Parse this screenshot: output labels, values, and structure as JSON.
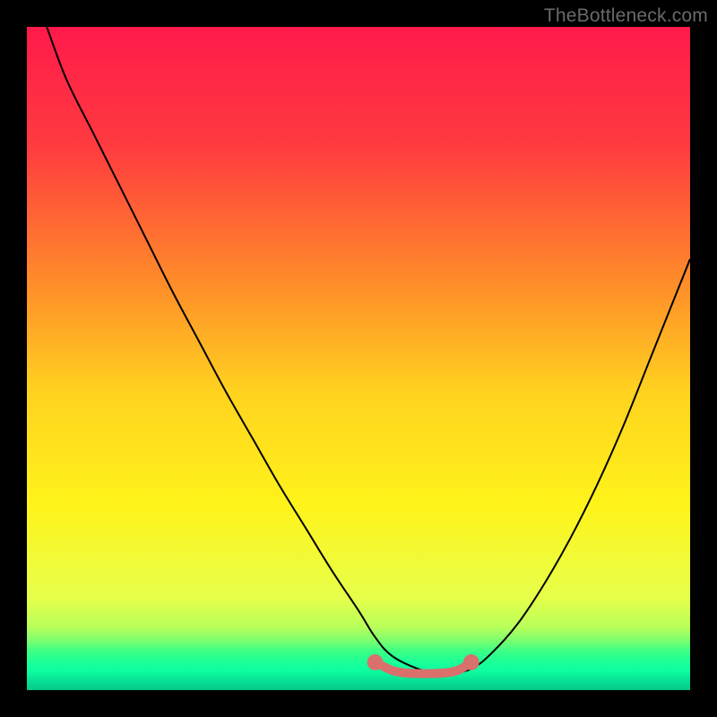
{
  "watermark": "TheBottleneck.com",
  "chart_data": {
    "type": "line",
    "title": "",
    "xlabel": "",
    "ylabel": "",
    "xlim": [
      0,
      100
    ],
    "ylim": [
      0,
      100
    ],
    "gradient_stops": [
      {
        "offset": 0.0,
        "color": "#ff1a4b"
      },
      {
        "offset": 0.18,
        "color": "#ff3b3f"
      },
      {
        "offset": 0.38,
        "color": "#ff8a2a"
      },
      {
        "offset": 0.55,
        "color": "#ffd21f"
      },
      {
        "offset": 0.72,
        "color": "#fff31a"
      },
      {
        "offset": 0.86,
        "color": "#e6ff4a"
      },
      {
        "offset": 0.905,
        "color": "#b8ff5a"
      },
      {
        "offset": 0.925,
        "color": "#7dff6e"
      },
      {
        "offset": 0.94,
        "color": "#3fff84"
      },
      {
        "offset": 0.955,
        "color": "#1fff95"
      },
      {
        "offset": 0.97,
        "color": "#0dffa0"
      },
      {
        "offset": 0.985,
        "color": "#07e296"
      },
      {
        "offset": 1.0,
        "color": "#04c987"
      }
    ],
    "series": [
      {
        "name": "bottleneck-curve",
        "color": "#000000",
        "stroke_width": 2,
        "x": [
          3,
          6,
          10,
          14,
          18,
          22,
          26,
          30,
          34,
          38,
          42,
          46,
          50,
          52.5,
          55,
          59,
          62,
          64,
          67,
          70,
          74,
          78,
          82,
          86,
          90,
          94,
          98,
          100
        ],
        "y": [
          100,
          92,
          84,
          76,
          68,
          60,
          52.5,
          45,
          38,
          31,
          24.5,
          18,
          12,
          8,
          5.2,
          3.2,
          2.6,
          2.6,
          3.2,
          5.5,
          10,
          16,
          23,
          31,
          40,
          50,
          60,
          65
        ]
      },
      {
        "name": "optimal-band",
        "color": "#d9706c",
        "stroke_width": 10,
        "linecap": "round",
        "x": [
          52.5,
          55,
          57,
          59,
          61,
          63,
          65,
          67
        ],
        "y": [
          4.2,
          3.0,
          2.6,
          2.5,
          2.5,
          2.6,
          3.0,
          4.2
        ]
      }
    ],
    "markers": [
      {
        "name": "optimal-start-dot",
        "x": 52.5,
        "y": 4.2,
        "r": 1.2,
        "color": "#d9706c"
      },
      {
        "name": "optimal-end-dot",
        "x": 67.0,
        "y": 4.2,
        "r": 1.2,
        "color": "#d9706c"
      }
    ]
  }
}
